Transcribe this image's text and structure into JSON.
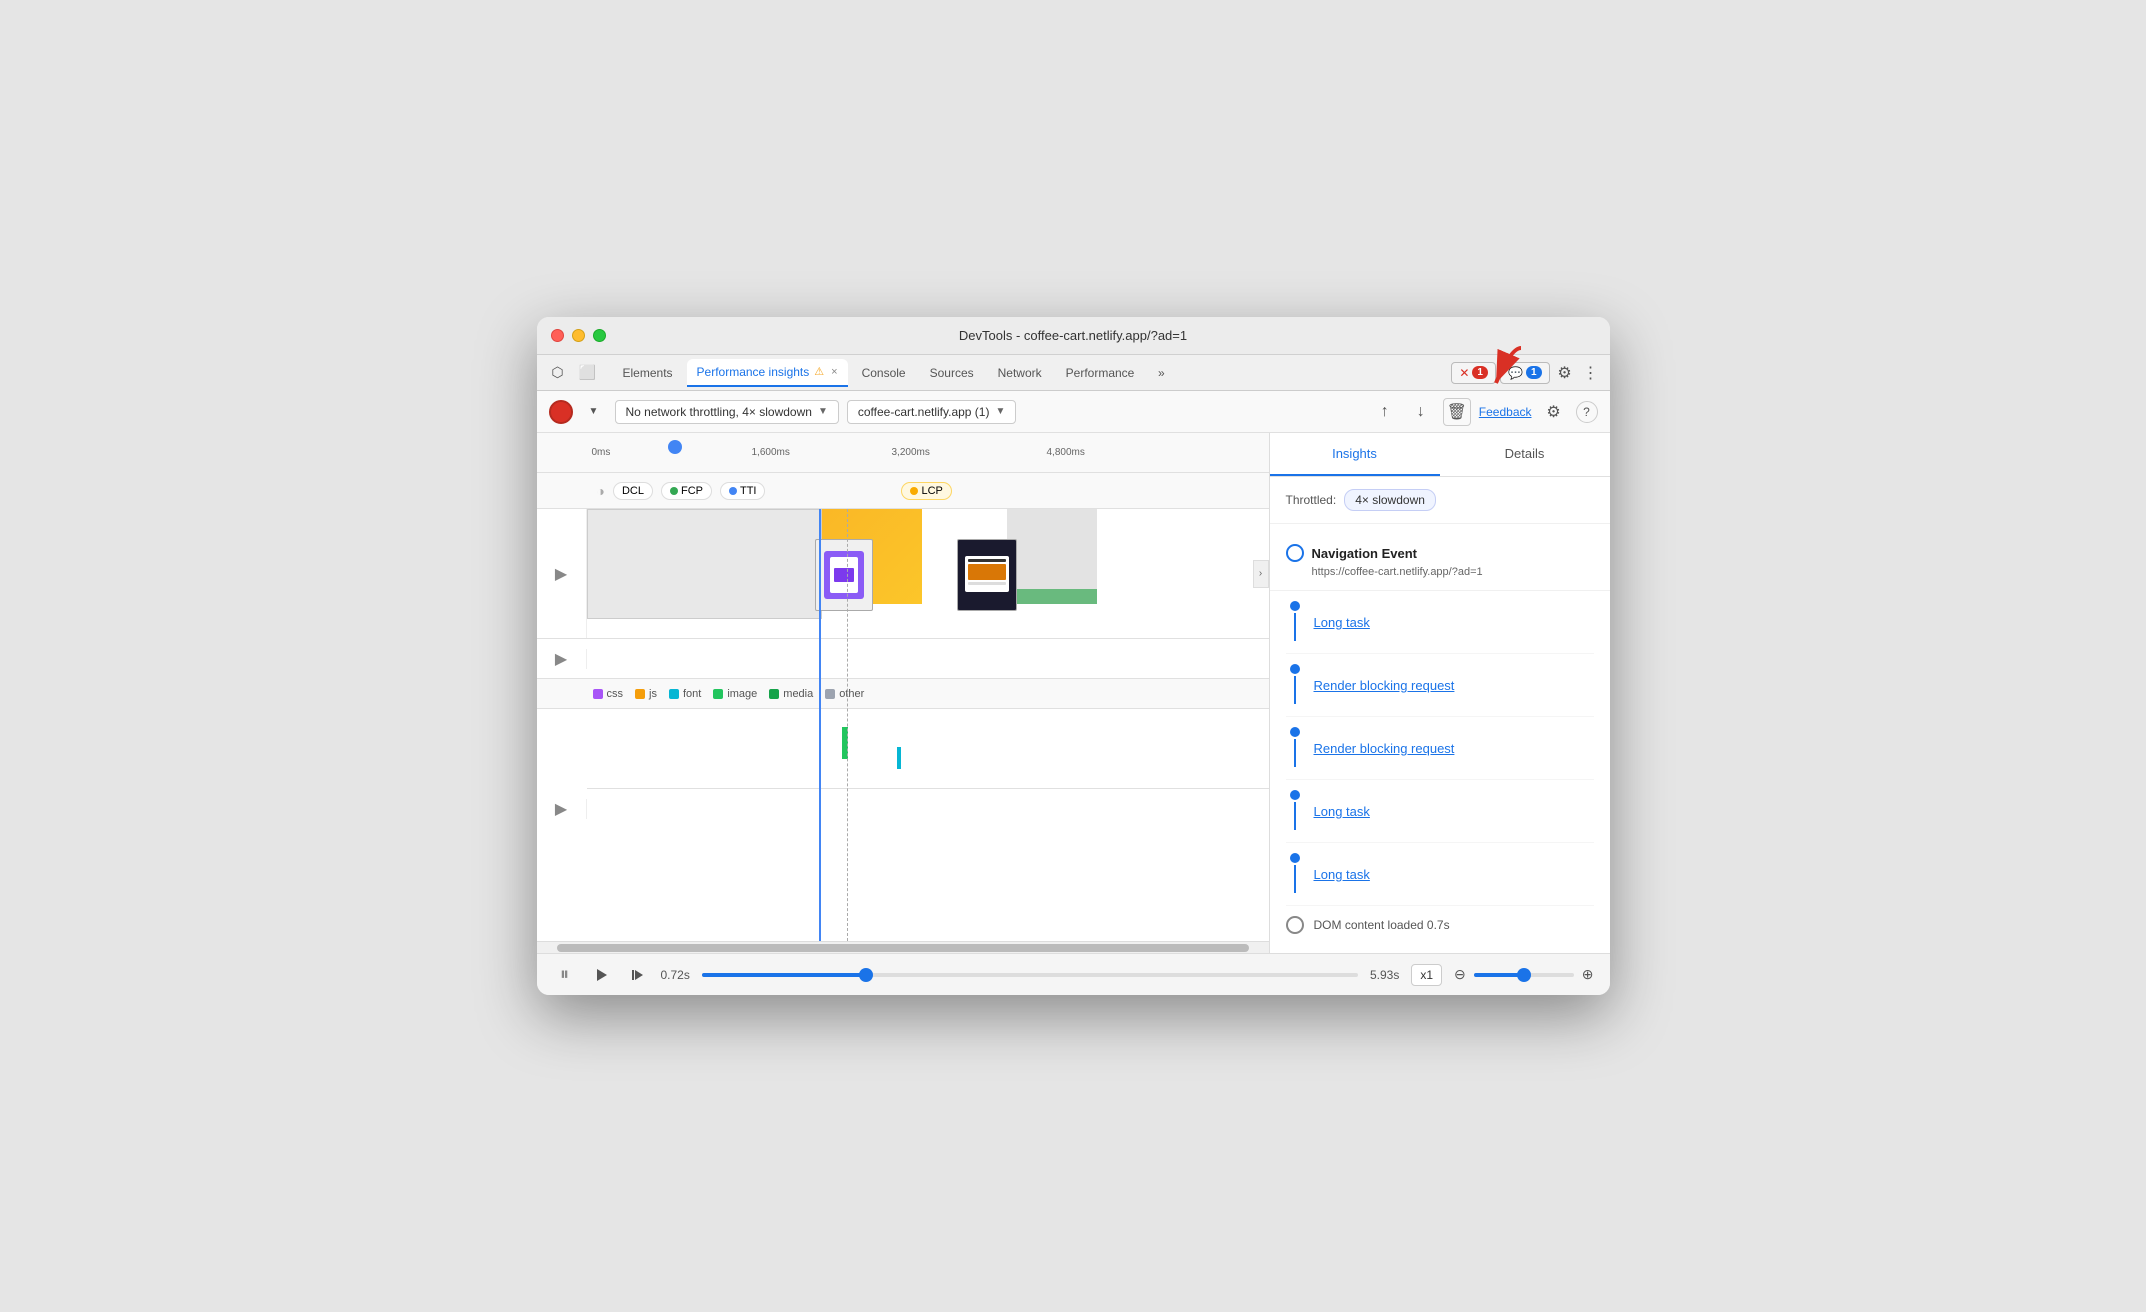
{
  "window": {
    "title": "DevTools - coffee-cart.netlify.app/?ad=1"
  },
  "tabs": [
    {
      "label": "Elements",
      "active": false,
      "id": "elements"
    },
    {
      "label": "Performance insights",
      "active": true,
      "id": "perf-insights",
      "hasWarning": true,
      "closeable": true
    },
    {
      "label": "Console",
      "active": false,
      "id": "console"
    },
    {
      "label": "Sources",
      "active": false,
      "id": "sources"
    },
    {
      "label": "Network",
      "active": false,
      "id": "network"
    },
    {
      "label": "Performance",
      "active": false,
      "id": "performance"
    },
    {
      "label": "More tabs",
      "active": false,
      "id": "more"
    }
  ],
  "tabbar": {
    "error_badge": "1",
    "message_badge": "1"
  },
  "toolbar": {
    "throttling_label": "No network throttling, 4× slowdown",
    "domain_label": "coffee-cart.netlify.app (1)",
    "feedback_label": "Feedback"
  },
  "timeline": {
    "times": [
      "0ms",
      "1,600ms",
      "3,200ms",
      "4,800ms"
    ],
    "markers": [
      "DCL",
      "FCP",
      "TTI",
      "LCP"
    ]
  },
  "legend": {
    "items": [
      {
        "label": "css",
        "color": "#a855f7"
      },
      {
        "label": "js",
        "color": "#f59e0b"
      },
      {
        "label": "font",
        "color": "#06b6d4"
      },
      {
        "label": "image",
        "color": "#22c55e"
      },
      {
        "label": "media",
        "color": "#16a34a"
      },
      {
        "label": "other",
        "color": "#9ca3af"
      }
    ]
  },
  "playbar": {
    "start_time": "0.72s",
    "end_time": "5.93s",
    "speed_label": "x1",
    "zoom_in_icon": "⊕",
    "zoom_out_icon": "⊖"
  },
  "insights_panel": {
    "tab_insights": "Insights",
    "tab_details": "Details",
    "throttle_label": "Throttled:",
    "throttle_value": "4× slowdown",
    "nav_event_title": "Navigation Event",
    "nav_event_url": "https://coffee-cart.netlify.app/?ad=1",
    "items": [
      {
        "label": "Long task",
        "type": "link"
      },
      {
        "label": "Render blocking request",
        "type": "link"
      },
      {
        "label": "Render blocking request",
        "type": "link"
      },
      {
        "label": "Long task",
        "type": "link"
      },
      {
        "label": "Long task",
        "type": "link"
      }
    ],
    "dom_event": "DOM content loaded 0.7s"
  }
}
